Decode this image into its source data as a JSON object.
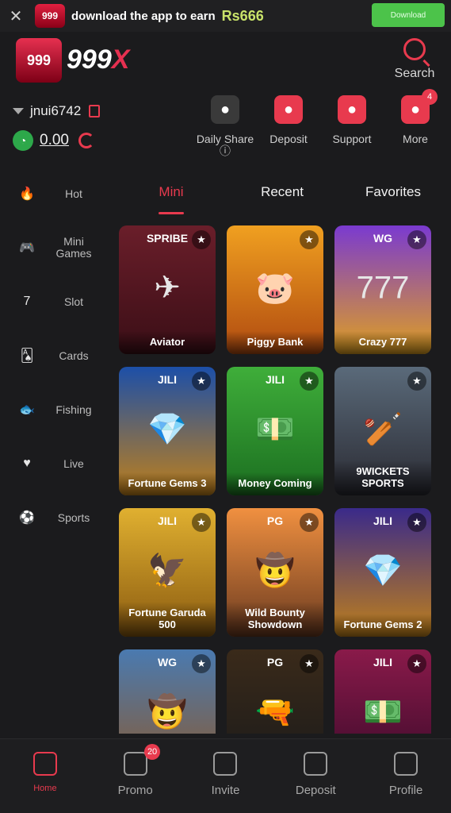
{
  "banner": {
    "close_icon": "close-icon",
    "app_logo": "999",
    "text": "download the app to earn",
    "amount": "Rs666",
    "download_button": "Download"
  },
  "header": {
    "logo_box": "999",
    "logo_text_white": "999",
    "logo_text_red": "X",
    "search_label": "Search"
  },
  "user": {
    "username": "jnui6742",
    "balance": "0.00"
  },
  "actions": [
    {
      "label": "Daily Share ⓘ",
      "icon": "wheel-icon",
      "color": "#3a3a3a"
    },
    {
      "label": "Deposit",
      "icon": "wallet-icon",
      "color": "#e83a4e"
    },
    {
      "label": "Support",
      "icon": "headset-icon",
      "color": "#e83a4e"
    },
    {
      "label": "More",
      "icon": "grid-icon",
      "color": "#e83a4e",
      "badge": "4"
    }
  ],
  "categories": [
    {
      "label": "Hot",
      "icon": "fire-icon",
      "glyph": "🔥"
    },
    {
      "label": "Mini Games",
      "icon": "mini-games-icon",
      "glyph": "🎮"
    },
    {
      "label": "Slot",
      "icon": "slot-icon",
      "glyph": "7"
    },
    {
      "label": "Cards",
      "icon": "cards-icon",
      "glyph": "🂡"
    },
    {
      "label": "Fishing",
      "icon": "fishing-icon",
      "glyph": "🐟"
    },
    {
      "label": "Live",
      "icon": "live-icon",
      "glyph": "♥"
    },
    {
      "label": "Sports",
      "icon": "soccer-icon",
      "glyph": "⚽"
    }
  ],
  "tabs": [
    {
      "label": "Mini",
      "active": true
    },
    {
      "label": "Recent",
      "active": false
    },
    {
      "label": "Favorites",
      "active": false
    }
  ],
  "games": [
    {
      "title": "Aviator",
      "provider": "SPRIBE",
      "bg": "linear-gradient(#6a1e2a,#3a0e16)",
      "art": "✈"
    },
    {
      "title": "Piggy Bank",
      "provider": "",
      "bg": "linear-gradient(#f0a020,#b04a10)",
      "art": "🐷"
    },
    {
      "title": "Crazy 777",
      "provider": "WG",
      "bg": "linear-gradient(#7a3ad0,#e0a020)",
      "art": "777"
    },
    {
      "title": "Fortune Gems 3",
      "provider": "JILI",
      "bg": "linear-gradient(#1c4fa8,#c0801a)",
      "art": "💎"
    },
    {
      "title": "Money Coming",
      "provider": "JILI",
      "bg": "linear-gradient(#3fae3a,#1b6e20)",
      "art": "💵"
    },
    {
      "title": "9WICKETS SPORTS",
      "provider": "",
      "bg": "linear-gradient(#5a6a7a,#2a2a32)",
      "art": "🏏"
    },
    {
      "title": "Fortune Garuda 500",
      "provider": "JILI",
      "bg": "linear-gradient(#e0b030,#8a5a10)",
      "art": "🦅"
    },
    {
      "title": "Wild Bounty Showdown",
      "provider": "PG",
      "bg": "linear-gradient(#f09040,#6a3a20)",
      "art": "🤠"
    },
    {
      "title": "Fortune Gems 2",
      "provider": "JILI",
      "bg": "linear-gradient(#3a2a8a,#c0801a)",
      "art": "💎"
    },
    {
      "title": "",
      "provider": "WG",
      "bg": "linear-gradient(#4a7ab0,#8a5a30)",
      "art": "🤠"
    },
    {
      "title": "",
      "provider": "PG",
      "bg": "linear-gradient(#3a2a1a,#1a1a1a)",
      "art": "🔫"
    },
    {
      "title": "",
      "provider": "JILI",
      "bg": "linear-gradient(#8a1a4a,#3a0a2a)",
      "art": "💵"
    }
  ],
  "bottom_nav": [
    {
      "label": "Home",
      "active": true,
      "icon": "home-icon"
    },
    {
      "label": "Promo",
      "active": false,
      "icon": "gift-icon",
      "badge": "20"
    },
    {
      "label": "Invite",
      "active": false,
      "icon": "invite-icon"
    },
    {
      "label": "Deposit",
      "active": false,
      "icon": "deposit-icon"
    },
    {
      "label": "Profile",
      "active": false,
      "icon": "profile-icon"
    }
  ]
}
